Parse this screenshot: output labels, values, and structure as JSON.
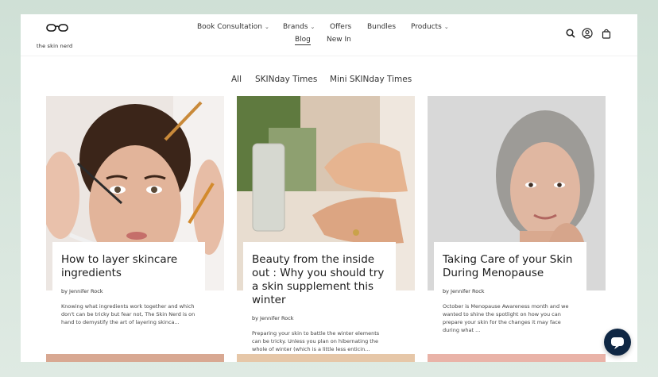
{
  "brand": {
    "name": "the skin nerd"
  },
  "nav": {
    "items": [
      {
        "label": "Book Consultation",
        "dropdown": true
      },
      {
        "label": "Brands",
        "dropdown": true
      },
      {
        "label": "Offers",
        "dropdown": false
      },
      {
        "label": "Bundles",
        "dropdown": false
      },
      {
        "label": "Products",
        "dropdown": true
      },
      {
        "label": "Blog",
        "dropdown": false,
        "active": true
      },
      {
        "label": "New In",
        "dropdown": false
      }
    ],
    "icons": [
      "search-icon",
      "account-icon",
      "cart-icon"
    ]
  },
  "filters": {
    "all": "All",
    "skinday": "SKINday Times",
    "mini": "Mini SKINday Times"
  },
  "cards": [
    {
      "title": "How to layer skincare ingredients",
      "author": "by Jennifer Rock",
      "excerpt": "Knowing what ingredients work together and which don't can be tricky but fear not, The Skin Nerd is on hand to demystify the art of layering skinca..."
    },
    {
      "title": "Beauty from the inside out : Why you should try a skin supplement this winter",
      "author": "by Jennifer Rock",
      "excerpt": "Preparing your skin to battle the winter elements can be tricky. Unless you plan on hibernating the whole of winter (which is a little less enticin..."
    },
    {
      "title": "Taking Care of your Skin During Menopause",
      "author": "by Jennifer Rock",
      "excerpt": "October is Menopause Awareness month and we wanted to shine the spotlight on how you can prepare your skin for the changes it may face during what ..."
    }
  ],
  "colors": {
    "chat_bubble": "#0f2744",
    "page_background": "#cfe0d6"
  }
}
